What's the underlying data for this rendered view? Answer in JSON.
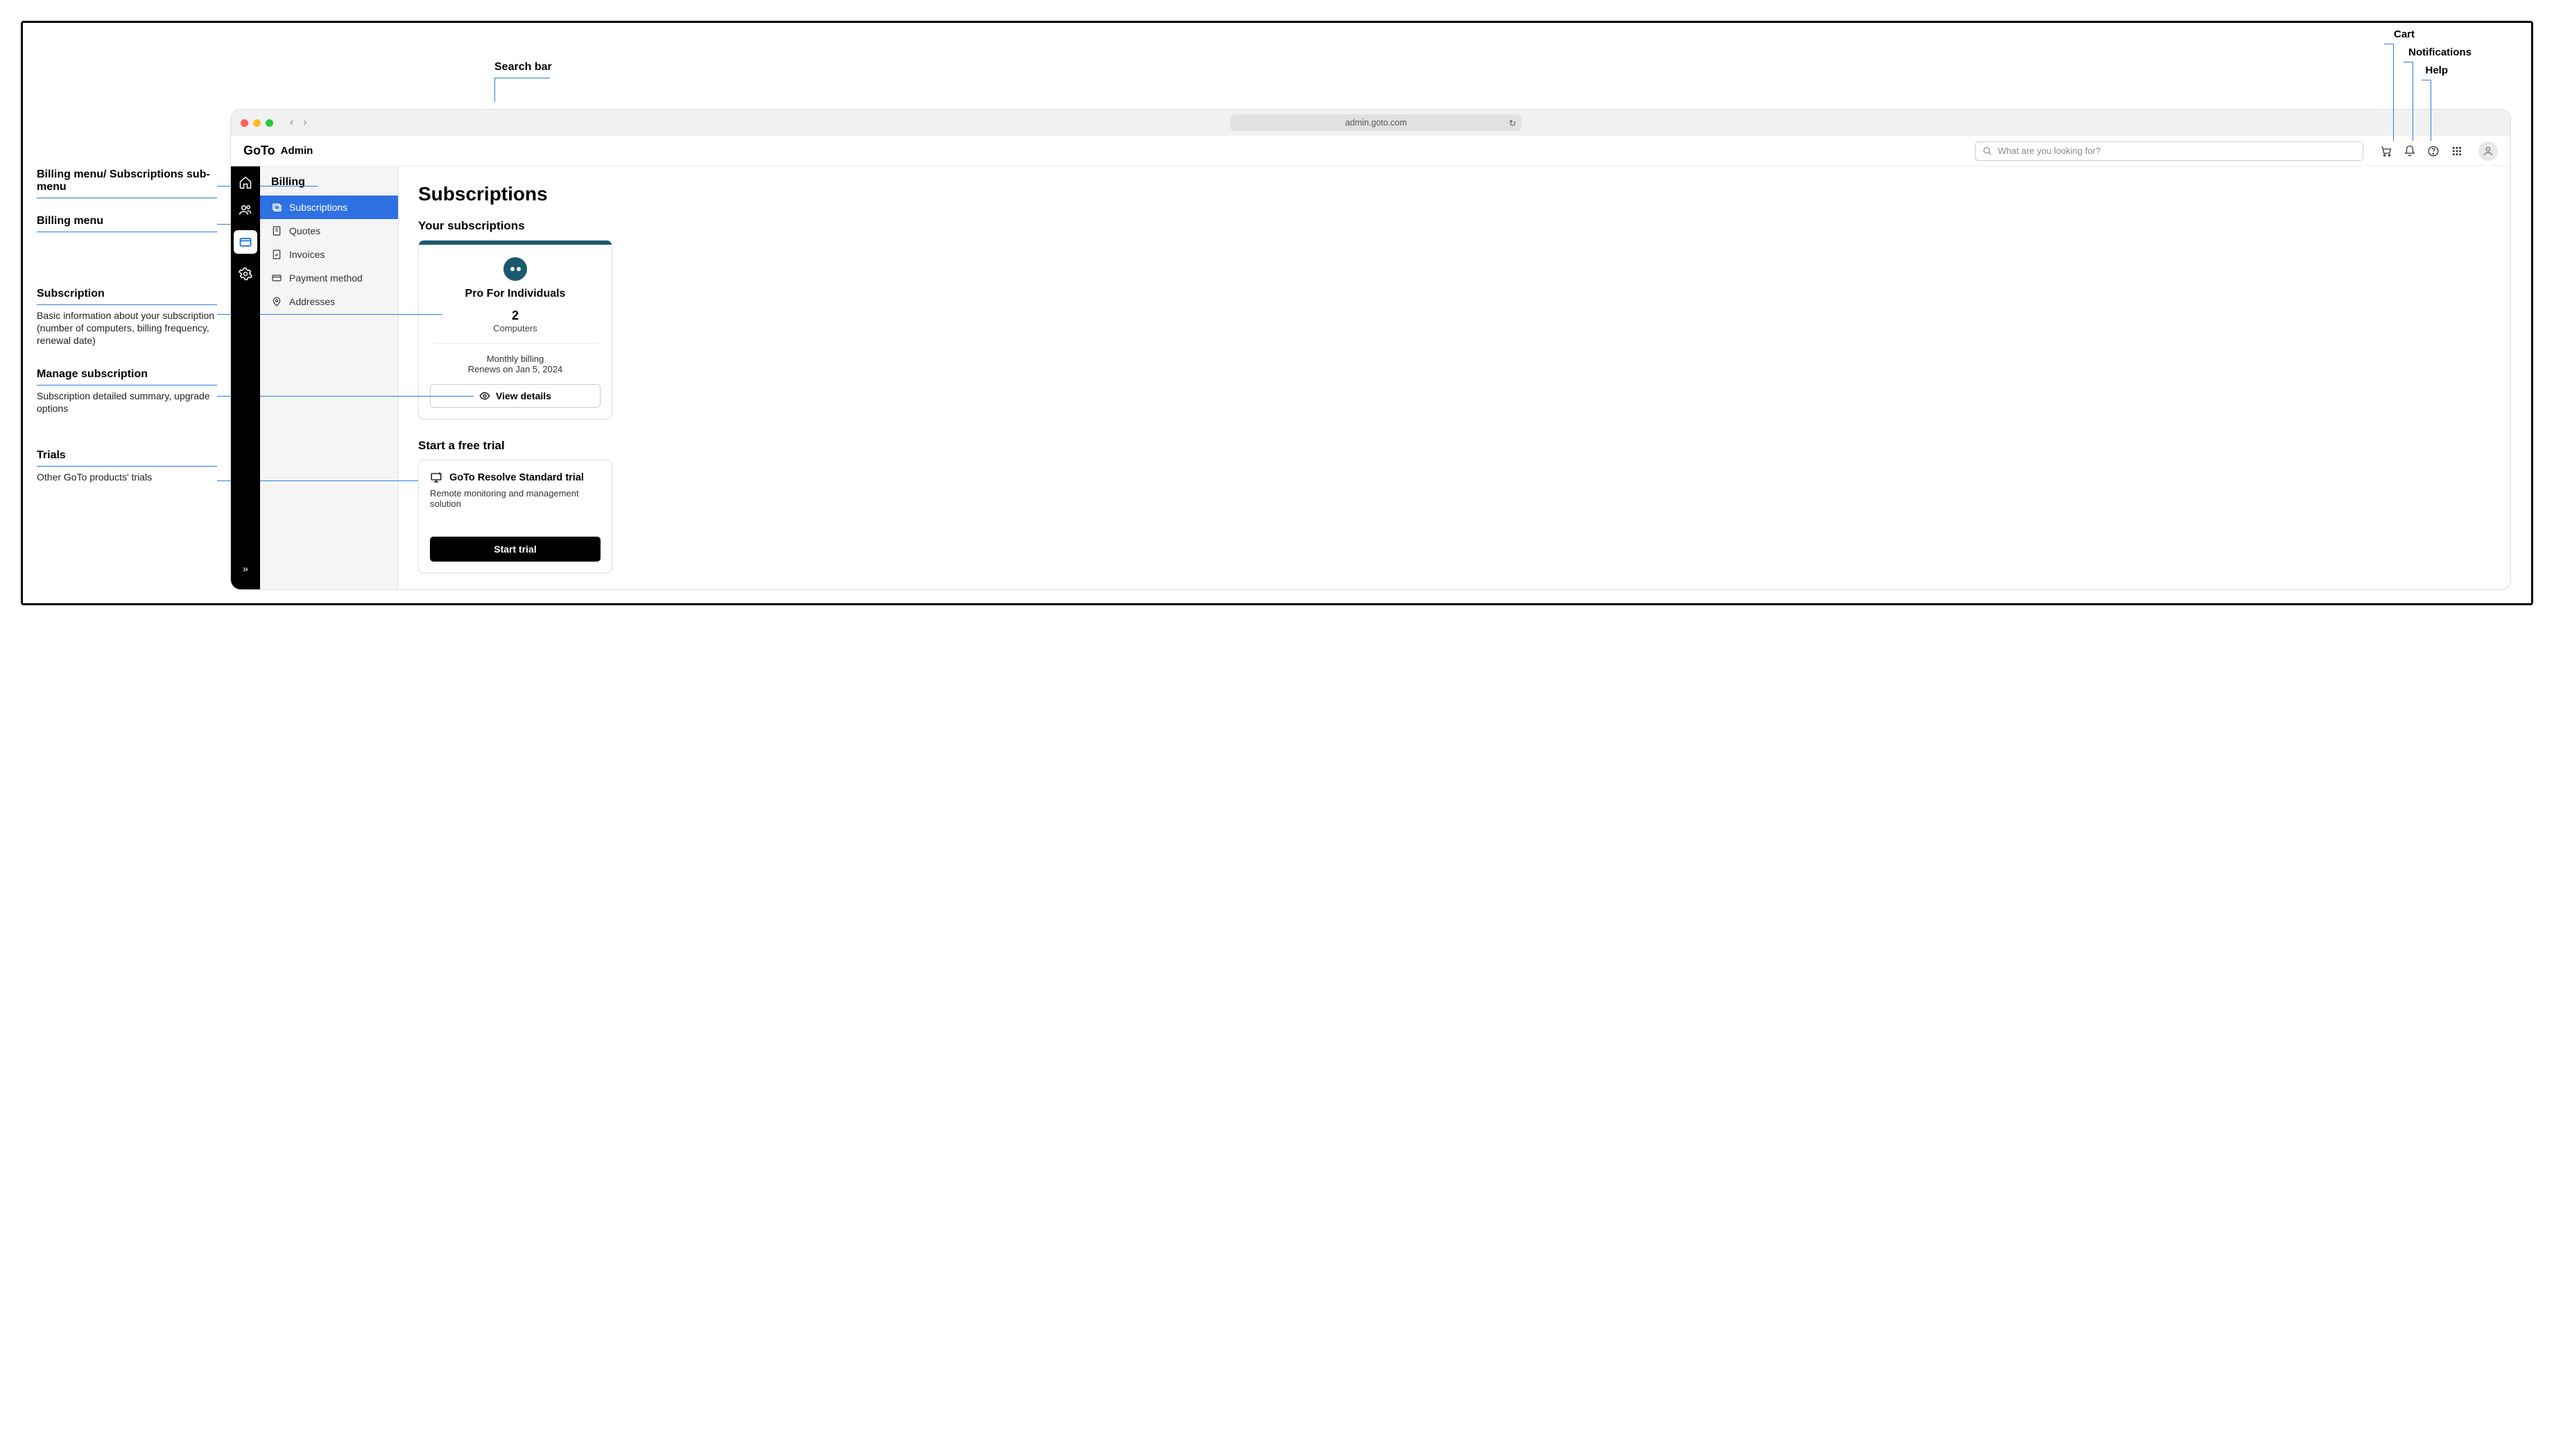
{
  "annotations": {
    "search_bar": "Search bar",
    "cart": "Cart",
    "notifications": "Notifications",
    "help": "Help",
    "billing_menu_sub": "Billing menu/ Subscriptions sub-menu",
    "billing_menu": "Billing menu",
    "subscription_h": "Subscription",
    "subscription_d": "Basic information about your subscription (number of computers, billing frequency, renewal date)",
    "manage_h": "Manage subscription",
    "manage_d": "Subscription detailed summary, upgrade options",
    "trials_h": "Trials",
    "trials_d": "Other GoTo products' trials"
  },
  "browser": {
    "url": "admin.goto.com"
  },
  "app": {
    "name": "Admin",
    "logo_text": "GoTo",
    "search_placeholder": "What are you looking for?"
  },
  "submenu": {
    "title": "Billing",
    "items": [
      {
        "label": "Subscriptions",
        "active": true
      },
      {
        "label": "Quotes"
      },
      {
        "label": "Invoices"
      },
      {
        "label": "Payment method"
      },
      {
        "label": "Addresses"
      }
    ]
  },
  "page": {
    "title": "Subscriptions",
    "your_subs": "Your subscriptions",
    "start_trial": "Start a free trial"
  },
  "subscription": {
    "product": "Pro For Individuals",
    "count": "2",
    "unit": "Computers",
    "billing": "Monthly billing",
    "renews": "Renews on Jan 5, 2024",
    "view_details": "View details"
  },
  "trial": {
    "name": "GoTo Resolve Standard trial",
    "desc": "Remote monitoring and management solution",
    "button": "Start trial"
  }
}
